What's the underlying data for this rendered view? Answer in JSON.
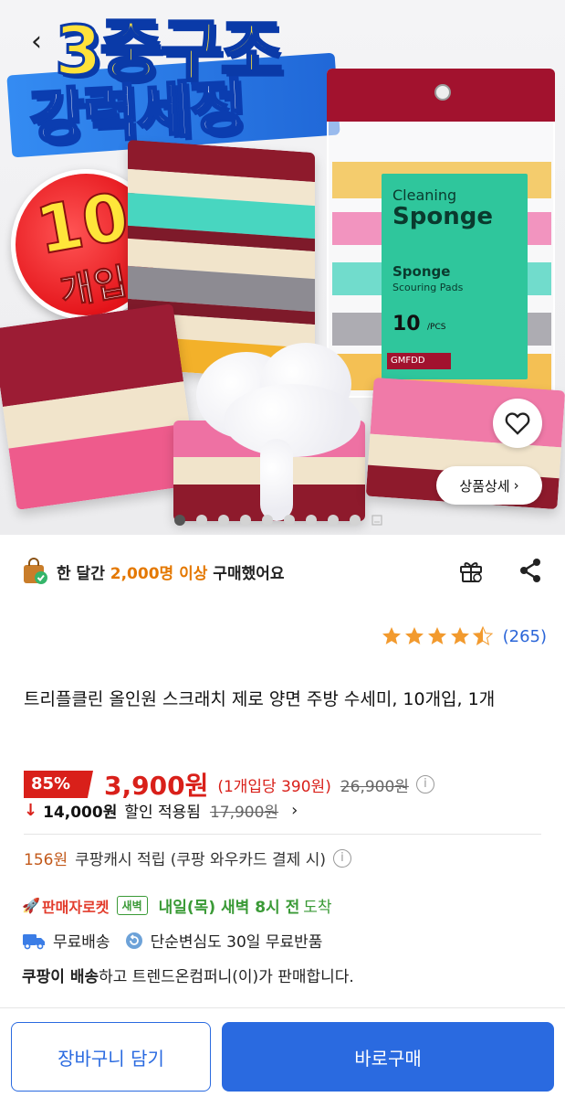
{
  "hero": {
    "headline_1": "3중구조",
    "headline_2": "강력세정",
    "badge_number": "10",
    "badge_unit": "개입",
    "package": {
      "line1": "Cleaning",
      "line2": "Sponge",
      "line3": "Sponge",
      "line4": "Scouring Pads",
      "count": "10",
      "count_unit": "/PCS",
      "brand": "GMFDD"
    },
    "detail_button_label": "상품상세",
    "carousel": {
      "total": 9,
      "active_index": 0
    }
  },
  "purchase_info": {
    "prefix": "한 달간 ",
    "highlight": "2,000명 이상",
    "suffix": " 구매했어요"
  },
  "rating": {
    "stars": 4.5,
    "review_count": "(265)"
  },
  "product": {
    "title": "트리플클린 올인원 스크래치 제로 양면 주방 수세미, 10개입, 1개"
  },
  "price": {
    "discount": "85%",
    "sale_price": "3,900원",
    "unit_price": "(1개입당 390원)",
    "original_price": "26,900원"
  },
  "coupon": {
    "amount": "14,000원",
    "label": "할인 적용됨",
    "original": "17,900원"
  },
  "cashback": {
    "amount": "156원",
    "text": "쿠팡캐시 적립 (쿠팡 와우카드 결제 시)"
  },
  "delivery": {
    "rocket_label": "판매자로켓",
    "dawn_badge": "새벽",
    "arrival": "내일(목) 새벽 8시 전",
    "arrival_suffix": "도착",
    "free_shipping": "무료배송",
    "free_return": "단순변심도 30일 무료반품"
  },
  "seller": {
    "bold": "쿠팡이 배송",
    "rest": "하고 트렌드온컴퍼니(이)가 판매합니다."
  },
  "actions": {
    "cart": "장바구니 담기",
    "buy": "바로구매"
  },
  "colors": {
    "accent_blue": "#2a6ae0",
    "price_red": "#d9201a",
    "rocket_green": "#3a9a36"
  }
}
